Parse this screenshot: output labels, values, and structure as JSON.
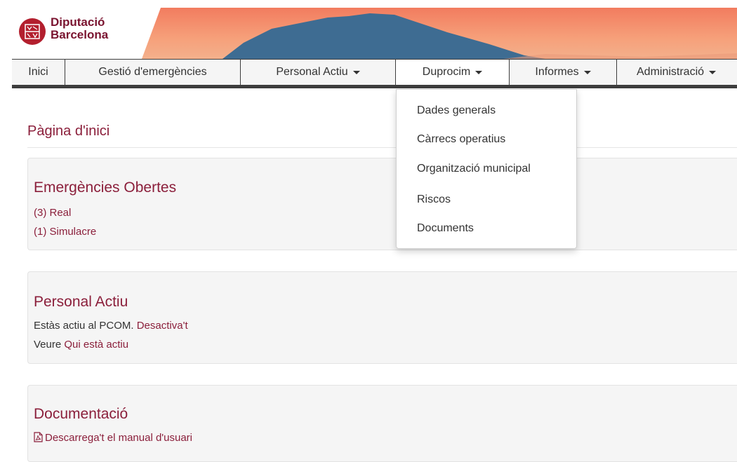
{
  "brand": {
    "line1": "Diputació",
    "line2": "Barcelona"
  },
  "nav": [
    {
      "label": "Inici",
      "caret": false
    },
    {
      "label": "Gestió d'emergències",
      "caret": false
    },
    {
      "label": "Personal Actiu",
      "caret": true
    },
    {
      "label": "Duprocim",
      "caret": true
    },
    {
      "label": "Informes",
      "caret": true
    },
    {
      "label": "Administració",
      "caret": true
    }
  ],
  "dropdown": {
    "items": [
      "Dades generals",
      "Càrrecs operatius",
      "Organització municipal",
      "Riscos",
      "Documents"
    ]
  },
  "page_title": "Pàgina d'inici",
  "emergencies": {
    "title": "Emergències Obertes",
    "real": "(3) Real",
    "simulacre": "(1) Simulacre"
  },
  "personal": {
    "title": "Personal Actiu",
    "status_text": "Estàs actiu al PCOM.",
    "deactivate": "Desactiva't",
    "see_prefix": "Veure",
    "who_active": "Qui està actiu"
  },
  "docs": {
    "title": "Documentació",
    "manual_link": "Descarrega't el manual d'usuari"
  },
  "colors": {
    "brand": "#8b1f3b",
    "accent": "#b31f2e",
    "nav_border": "#3d3d3d"
  }
}
